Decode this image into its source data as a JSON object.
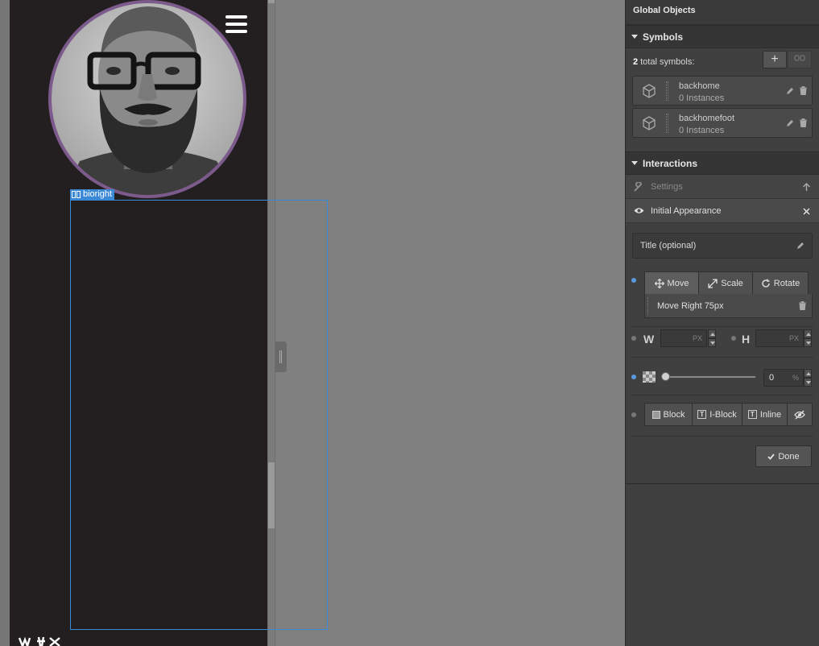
{
  "canvas": {
    "element_tag": "bioright",
    "page_bg": "#231f20",
    "accent": "#3b89d6"
  },
  "panel": {
    "header": "Global Objects",
    "symbols": {
      "title": "Symbols",
      "count_number": "2",
      "count_suffix": "total symbols:",
      "add_label": "+",
      "items": [
        {
          "name": "backhome",
          "instances": "0 Instances"
        },
        {
          "name": "backhomefoot",
          "instances": "0 Instances"
        }
      ]
    },
    "interactions": {
      "title": "Interactions",
      "settings_label": "Settings",
      "initial_appearance_label": "Initial Appearance",
      "title_placeholder": "Title (optional)",
      "transform_tabs": [
        "Move",
        "Scale",
        "Rotate"
      ],
      "move_item": "Move Right 75px",
      "width_label": "W",
      "height_label": "H",
      "unit_px": "PX",
      "opacity_value": "0",
      "opacity_unit": "%",
      "display_tabs": [
        "Block",
        "I-Block",
        "Inline"
      ],
      "done_label": "Done"
    }
  }
}
